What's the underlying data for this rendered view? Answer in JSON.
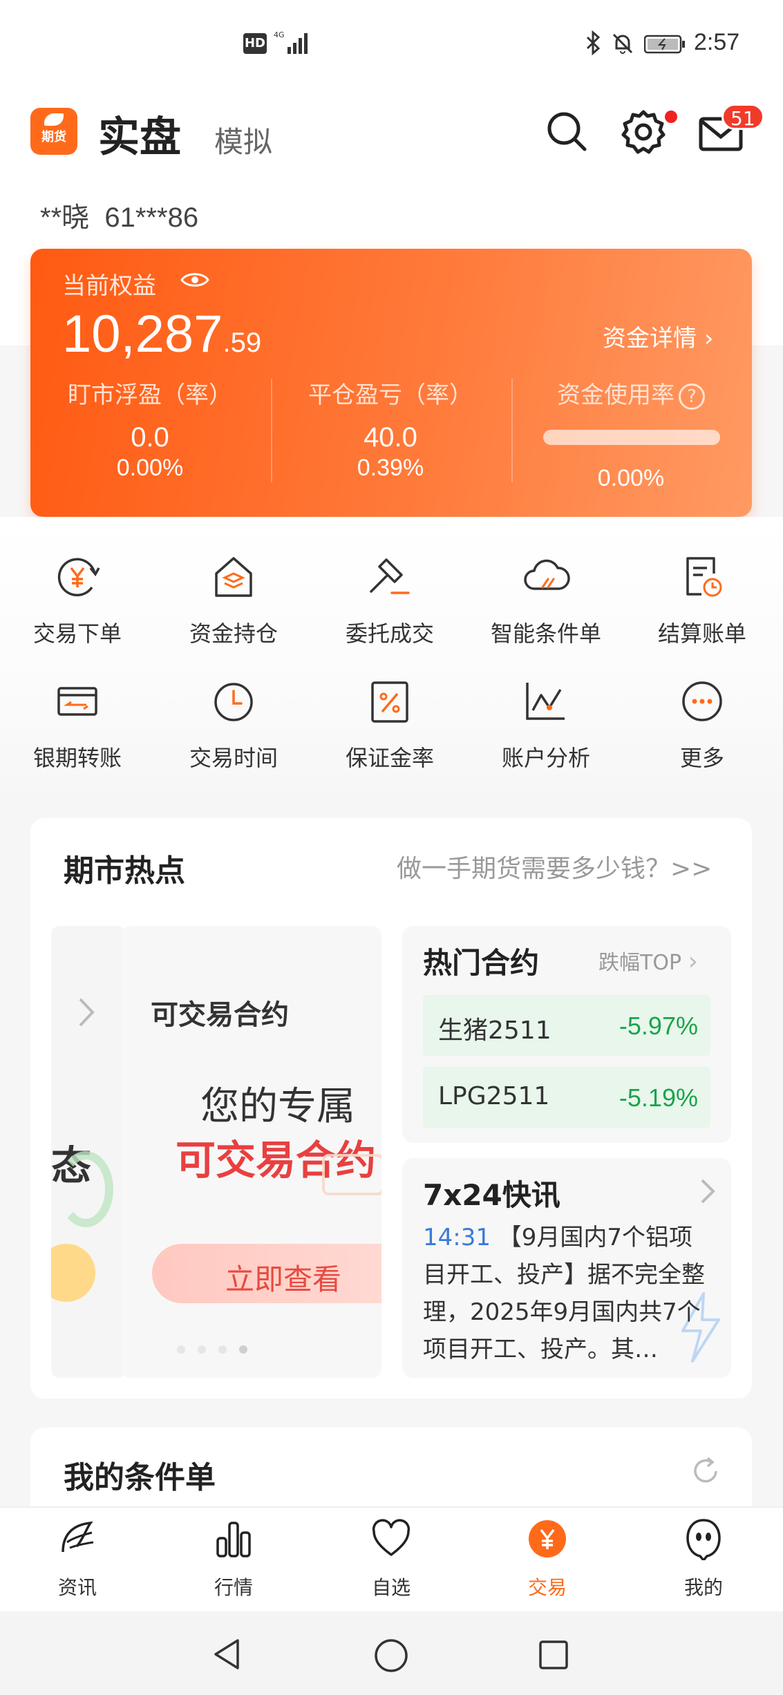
{
  "status_bar": {
    "hd": "HD",
    "network": "4G",
    "time": "2:57"
  },
  "header": {
    "logo_text": "期货",
    "tab_real": "实盘",
    "tab_sim": "模拟",
    "mail_badge": "51"
  },
  "account": {
    "name": "**晓",
    "id": "61***86"
  },
  "equity": {
    "label": "当前权益",
    "value_main": "10,287",
    "value_decimal": ".59",
    "detail_link": "资金详情",
    "metrics": [
      {
        "title": "盯市浮盈（率）",
        "value": "0.0",
        "pct": "0.00%"
      },
      {
        "title": "平仓盈亏（率）",
        "value": "40.0",
        "pct": "0.39%"
      },
      {
        "title": "资金使用率",
        "value": "",
        "pct": "0.00%",
        "usage": 0.0
      }
    ],
    "help_icon": "?"
  },
  "functions": [
    {
      "label": "交易下单",
      "icon": "yuan-cycle-icon"
    },
    {
      "label": "资金持仓",
      "icon": "house-layers-icon"
    },
    {
      "label": "委托成交",
      "icon": "hammer-icon"
    },
    {
      "label": "智能条件单",
      "icon": "cloud-icon"
    },
    {
      "label": "结算账单",
      "icon": "bill-clock-icon"
    },
    {
      "label": "银期转账",
      "icon": "card-transfer-icon"
    },
    {
      "label": "交易时间",
      "icon": "clock-icon"
    },
    {
      "label": "保证金率",
      "icon": "percent-icon"
    },
    {
      "label": "账户分析",
      "icon": "line-chart-icon"
    },
    {
      "label": "更多",
      "icon": "more-icon"
    }
  ],
  "hot_panel": {
    "title": "期市热点",
    "link": "做一手期货需要多少钱？>>",
    "slide_prev_char": "态",
    "slide": {
      "title": "可交易合约",
      "line1": "您的专属",
      "line2": "可交易合约",
      "button": "立即查看"
    },
    "hot_contracts": {
      "title": "热门合约",
      "sub": "跌幅TOP",
      "rows": [
        {
          "name": "生猪2511",
          "change": "-5.97%"
        },
        {
          "name": "LPG2511",
          "change": "-5.19%"
        }
      ]
    },
    "news": {
      "title": "7x24快讯",
      "time": "14:31",
      "text": "【9月国内7个铝项目开工、投产】据不完全整理，2025年9月国内共7个项目开工、投产。其…"
    }
  },
  "conditions": {
    "title": "我的条件单"
  },
  "bottom_nav": [
    {
      "label": "资讯",
      "icon": "news-icon"
    },
    {
      "label": "行情",
      "icon": "bar-chart-icon"
    },
    {
      "label": "自选",
      "icon": "heart-icon"
    },
    {
      "label": "交易",
      "icon": "trade-yuan-icon"
    },
    {
      "label": "我的",
      "icon": "profile-icon"
    }
  ],
  "colors": {
    "accent": "#ff6a1a",
    "down_green": "#1aa349",
    "link_blue": "#3a7bd5"
  }
}
